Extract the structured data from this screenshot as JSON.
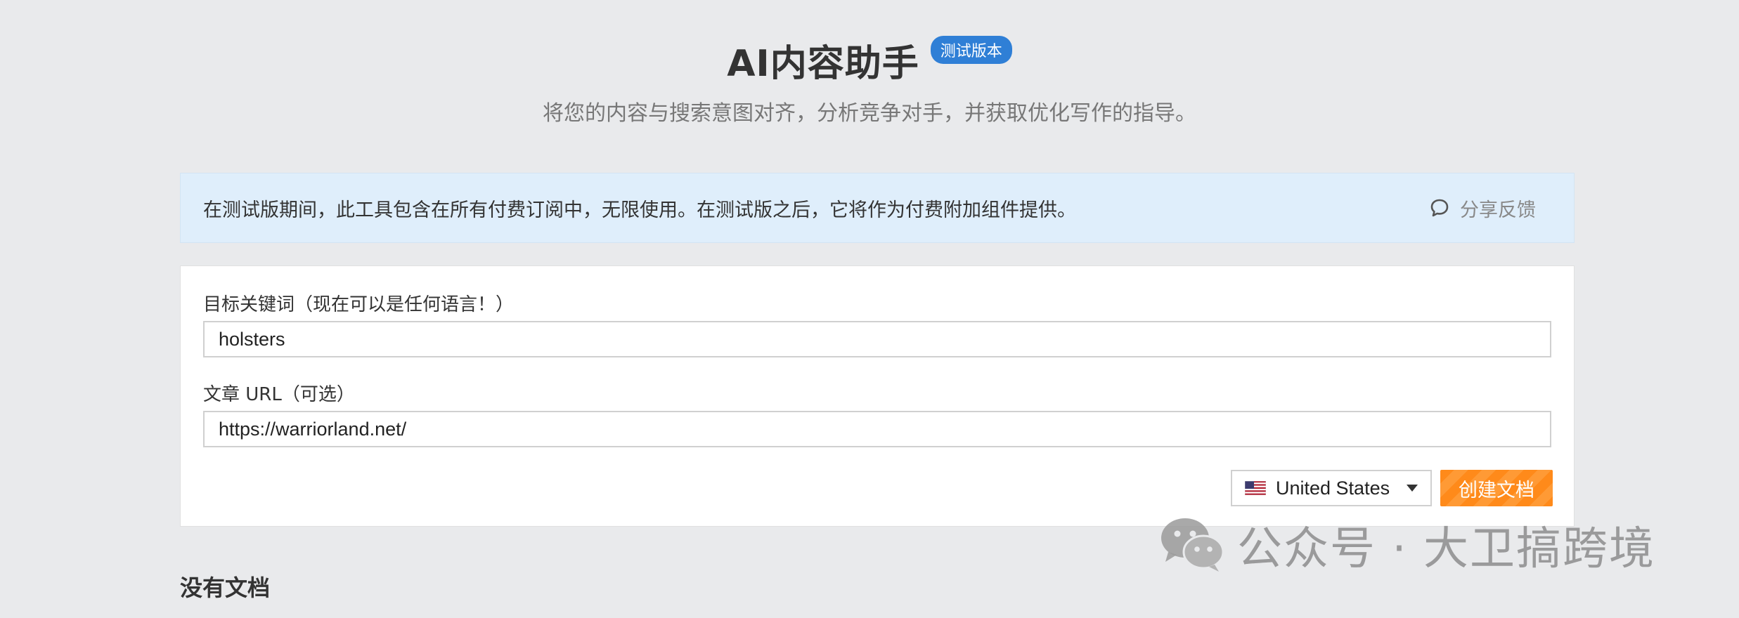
{
  "header": {
    "title": "AI内容助手",
    "badge": "测试版本",
    "subtitle": "将您的内容与搜索意图对齐，分析竞争对手，并获取优化写作的指导。"
  },
  "banner": {
    "text": "在测试版期间，此工具包含在所有付费订阅中，无限使用。在测试版之后，它将作为付费附加组件提供。",
    "feedback_label": "分享反馈",
    "feedback_icon": "chat-bubble-icon"
  },
  "form": {
    "keyword_label": "目标关键词（现在可以是任何语言！）",
    "keyword_value": "holsters",
    "url_label": "文章 URL（可选）",
    "url_value": "https://warriorland.net/",
    "country_value": "United States",
    "country_flag": "us-flag-icon",
    "create_label": "创建文档"
  },
  "documents": {
    "empty_label": "没有文档"
  },
  "watermark": {
    "text": "公众号 · 大卫搞跨境",
    "icon": "wechat-icon"
  },
  "colors": {
    "badge": "#2f7fd6",
    "banner_bg": "#dfeefb",
    "create_button": "#ff8a1a",
    "page_bg": "#e9eaec"
  }
}
